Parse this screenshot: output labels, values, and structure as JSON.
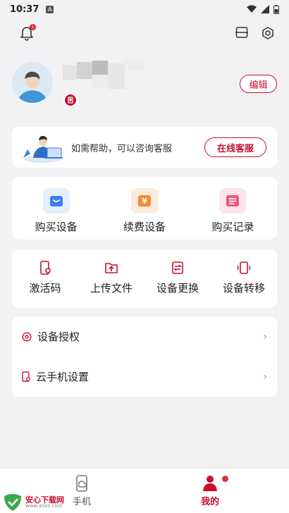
{
  "status_bar": {
    "time": "10:37",
    "notification_badge": "A"
  },
  "header": {
    "bell_badge": "1"
  },
  "profile": {
    "edit_label": "编辑"
  },
  "help": {
    "text": "如需帮助，可以咨询客服",
    "online_service_label": "在线客服"
  },
  "purchase": {
    "items": [
      {
        "label": "购买设备",
        "icon": "shopping-bag-icon",
        "bg": "#e4effd",
        "fg": "#3d7ef0"
      },
      {
        "label": "续费设备",
        "icon": "yen-coin-icon",
        "bg": "#fdeadb",
        "fg": "#f08c35"
      },
      {
        "label": "购买记录",
        "icon": "list-record-icon",
        "bg": "#fde3ea",
        "fg": "#e85a7a"
      }
    ]
  },
  "tools": {
    "items": [
      {
        "label": "激活码",
        "icon": "activation-code-icon"
      },
      {
        "label": "上传文件",
        "icon": "upload-file-icon"
      },
      {
        "label": "设备更换",
        "icon": "device-swap-icon"
      },
      {
        "label": "设备转移",
        "icon": "device-transfer-icon"
      }
    ]
  },
  "list": {
    "items": [
      {
        "label": "设备授权",
        "icon": "authorize-icon"
      },
      {
        "label": "云手机设置",
        "icon": "cloud-phone-settings-icon"
      }
    ]
  },
  "bottom_nav": {
    "phone_label": "手机",
    "mine_label": "我的"
  },
  "watermark": {
    "title": "安心下载网",
    "url": "www.anxz.com"
  },
  "colors": {
    "brand": "#c8102e",
    "background": "#f2f2f4"
  }
}
